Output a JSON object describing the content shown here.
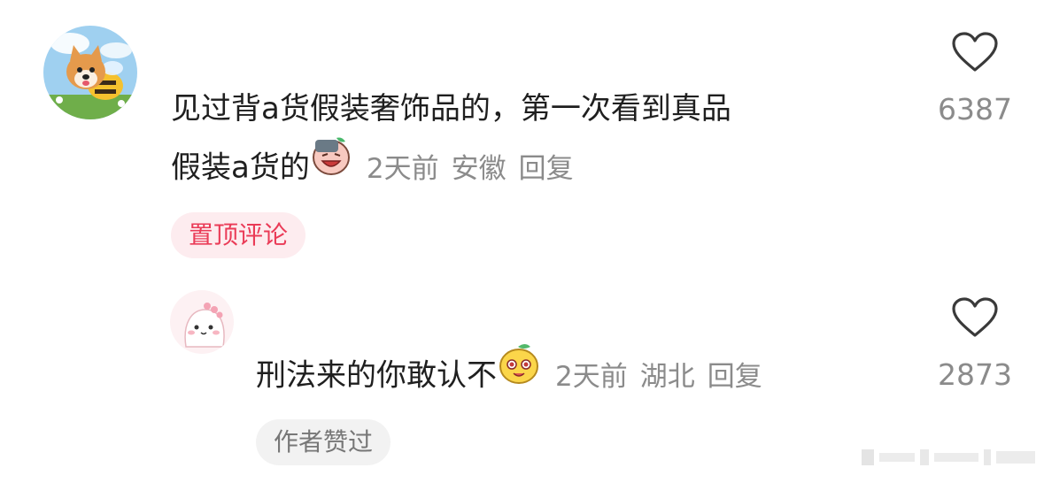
{
  "comments": [
    {
      "line1": "见过背a货假装奢饰品的，第一次看到真品",
      "line2": "假装a货的",
      "emoji": "facepalm-emoji",
      "time": "2天前",
      "location": "安徽",
      "reply_label": "回复",
      "likes": "6387",
      "badge": "置顶评论",
      "avatar": "shiba-dog-bee-avatar"
    },
    {
      "text": "刑法来的你敢认不",
      "emoji": "smug-lemon-emoji",
      "time": "2天前",
      "location": "湖北",
      "reply_label": "回复",
      "likes": "2873",
      "badge": "作者赞过",
      "avatar": "pink-dinosaur-avatar"
    }
  ],
  "colors": {
    "text": "#1f1f1f",
    "meta": "#8b8b8b",
    "pinned_bg": "#fdecef",
    "pinned_text": "#ea3b57",
    "author_like_bg": "#f2f2f2"
  }
}
